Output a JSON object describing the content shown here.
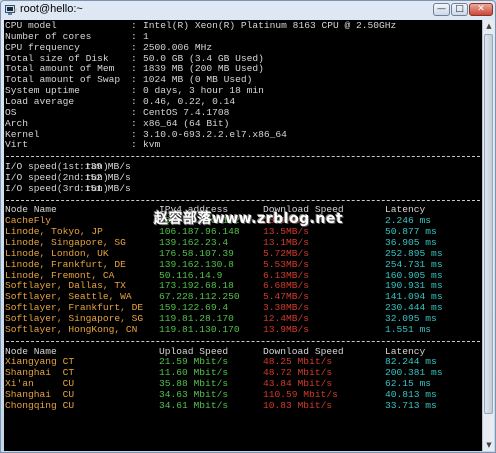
{
  "window": {
    "title": "root@hello:~"
  },
  "sysinfo": [
    {
      "label": "CPU model",
      "value": "Intel(R) Xeon(R) Platinum 8163 CPU @ 2.50GHz"
    },
    {
      "label": "Number of cores",
      "value": "1"
    },
    {
      "label": "CPU frequency",
      "value": "2500.006 MHz"
    },
    {
      "label": "Total size of Disk",
      "value": "50.0 GB (3.4 GB Used)"
    },
    {
      "label": "Total amount of Mem",
      "value": "1839 MB (200 MB Used)"
    },
    {
      "label": "Total amount of Swap",
      "value": "1024 MB (0 MB Used)"
    },
    {
      "label": "System uptime",
      "value": "0 days, 3 hour 18 min"
    },
    {
      "label": "Load average",
      "value": "0.46, 0.22, 0.14"
    },
    {
      "label": "OS",
      "value": "CentOS 7.4.1708"
    },
    {
      "label": "Arch",
      "value": "x86_64 (64 Bit)"
    },
    {
      "label": "Kernel",
      "value": "3.10.0-693.2.2.el7.x86_64"
    },
    {
      "label": "Virt",
      "value": "kvm"
    }
  ],
  "io": [
    {
      "label": "I/O speed(1st run)",
      "value": ":139 MB/s"
    },
    {
      "label": "I/O speed(2nd run)",
      "value": ":152 MB/s"
    },
    {
      "label": "I/O speed(3rd run)",
      "value": ":151 MB/s"
    }
  ],
  "table1": {
    "headers": [
      "Node Name",
      "IPv4 address",
      "Download Speed",
      "Latency"
    ],
    "rows": [
      [
        "CacheFly",
        "204.93.150.152",
        "13.9MB/s",
        "2.246 ms"
      ],
      [
        "Linode, Tokyo, JP",
        "106.187.96.148",
        "13.5MB/s",
        "50.877 ms"
      ],
      [
        "Linode, Singapore, SG",
        "139.162.23.4",
        "13.1MB/s",
        "36.905 ms"
      ],
      [
        "Linode, London, UK",
        "176.58.107.39",
        "5.72MB/s",
        "252.895 ms"
      ],
      [
        "Linode, Frankfurt, DE",
        "139.162.130.8",
        "5.53MB/s",
        "254.731 ms"
      ],
      [
        "Linode, Fremont, CA",
        "50.116.14.9",
        "6.13MB/s",
        "160.905 ms"
      ],
      [
        "Softlayer, Dallas, TX",
        "173.192.68.18",
        "6.68MB/s",
        "190.931 ms"
      ],
      [
        "Softlayer, Seattle, WA",
        "67.228.112.250",
        "5.47MB/s",
        "141.094 ms"
      ],
      [
        "Softlayer, Frankfurt, DE",
        "159.122.69.4",
        "3.38MB/s",
        "230.444 ms"
      ],
      [
        "Softlayer, Singapore, SG",
        "119.81.28.170",
        "12.4MB/s",
        "32.095 ms"
      ],
      [
        "Softlayer, HongKong, CN",
        "119.81.130.170",
        "13.9MB/s",
        "1.551 ms"
      ]
    ]
  },
  "table2": {
    "headers": [
      "Node Name",
      "Upload Speed",
      "Download Speed",
      "Latency"
    ],
    "rows": [
      [
        "Xiangyang CT",
        "21.59 Mbit/s",
        "48.25 Mbit/s",
        "82.244 ms"
      ],
      [
        "Shanghai  CT",
        "11.60 Mbit/s",
        "48.72 Mbit/s",
        "200.381 ms"
      ],
      [
        "Xi'an     CU",
        "35.88 Mbit/s",
        "43.84 Mbit/s",
        "62.15 ms"
      ],
      [
        "Shanghai  CU",
        "34.63 Mbit/s",
        "110.59 Mbit/s",
        "40.813 ms"
      ],
      [
        "Chongqing CU",
        "34.61 Mbit/s",
        "10.83 Mbit/s",
        "33.713 ms"
      ]
    ]
  },
  "watermark": "赵容部落www.zrblog.net",
  "colors": {
    "node_name": "#e8a33c",
    "ip_upload": "#51c34a",
    "download": "#d23a2a",
    "latency": "#36c6c4",
    "terminal_bg": "#000000"
  },
  "icons": {
    "app": "putty-terminal-icon",
    "minimize": "minimize-icon",
    "maximize": "maximize-icon",
    "close": "close-icon"
  }
}
